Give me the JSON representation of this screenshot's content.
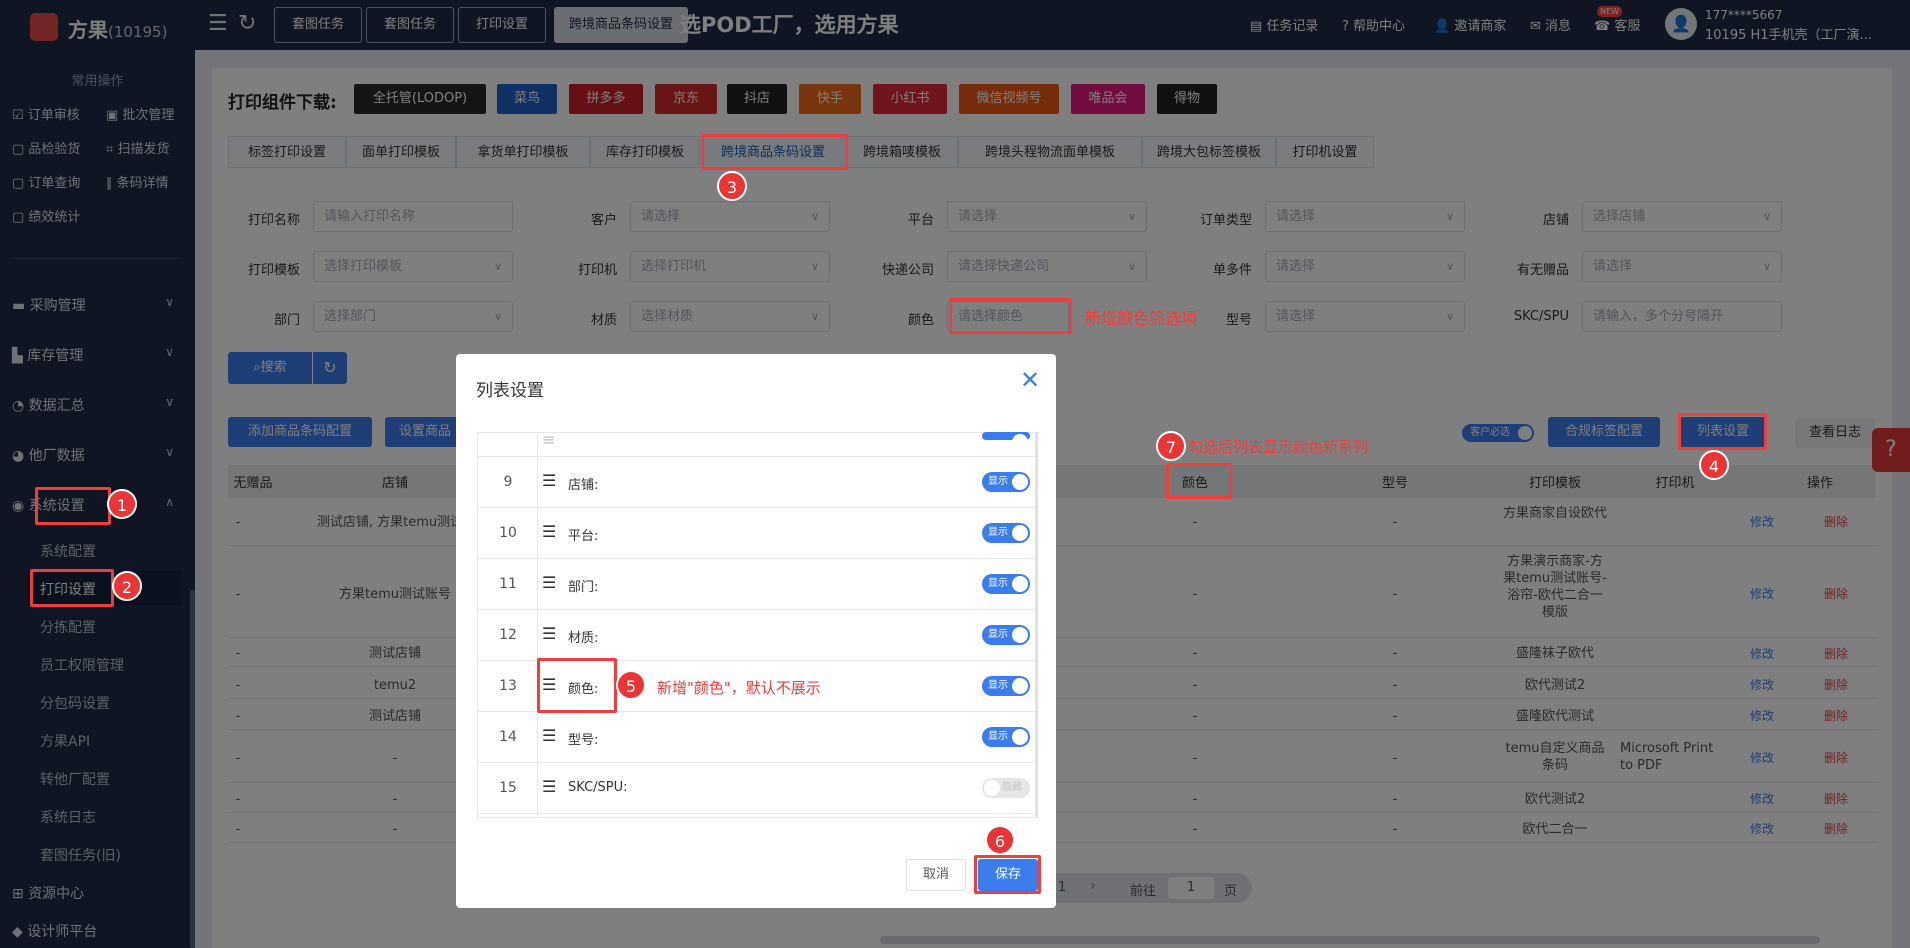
{
  "app": {
    "name": "方果",
    "count": "(10195)"
  },
  "topbar": {
    "buttons": [
      "套图任务",
      "套图任务",
      "打印设置",
      "跨境商品条码设置"
    ],
    "banner": "选POD工厂，选用方果",
    "right": [
      "任务记录",
      "帮助中心",
      "邀请商家",
      "消息",
      "客服"
    ],
    "new_badge": "NEW",
    "user_phone": "177****5667",
    "user_name": "10195  H1手机壳（工厂演..."
  },
  "sidebar": {
    "common_title": "常用操作",
    "quick": [
      "订单审核",
      "批次管理",
      "品检验货",
      "扫描发货",
      "订单查询",
      "条码详情",
      "绩效统计"
    ],
    "menus": [
      "采购管理",
      "库存管理",
      "数据汇总",
      "他厂数据",
      "系统设置"
    ],
    "sub": [
      "系统配置",
      "打印设置",
      "分拣配置",
      "员工权限管理",
      "分包码设置",
      "方果API",
      "转他厂配置",
      "系统日志",
      "套图任务(旧)"
    ],
    "bottom": [
      "资源中心",
      "设计师平台"
    ]
  },
  "downloads": {
    "label": "打印组件下载:",
    "items": [
      "全托管(LODOP)",
      "菜鸟",
      "拼多多",
      "京东",
      "抖店",
      "快手",
      "小红书",
      "微信视频号",
      "唯品会",
      "得物"
    ]
  },
  "tabs": [
    "标签打印设置",
    "面单打印模板",
    "拿货单打印模板",
    "库存打印模板",
    "跨境商品条码设置",
    "跨境箱唛模板",
    "跨境头程物流面单模板",
    "跨境大包标签模板",
    "打印机设置"
  ],
  "filters": {
    "row1": [
      {
        "label": "打印名称",
        "ph": "请输入打印名称"
      },
      {
        "label": "客户",
        "ph": "请选择"
      },
      {
        "label": "平台",
        "ph": "请选择"
      },
      {
        "label": "订单类型",
        "ph": "请选择"
      },
      {
        "label": "店铺",
        "ph": "选择店铺"
      }
    ],
    "row2": [
      {
        "label": "打印模板",
        "ph": "选择打印模板"
      },
      {
        "label": "打印机",
        "ph": "选择打印机"
      },
      {
        "label": "快递公司",
        "ph": "请选择快递公司"
      },
      {
        "label": "单多件",
        "ph": "请选择"
      },
      {
        "label": "有无赠品",
        "ph": "请选择"
      }
    ],
    "row3": [
      {
        "label": "部门",
        "ph": "选择部门"
      },
      {
        "label": "材质",
        "ph": "选择材质"
      },
      {
        "label": "颜色",
        "ph": "请选择颜色"
      },
      {
        "label": "型号",
        "ph": "请选择"
      },
      {
        "label": "SKC/SPU",
        "ph": "请输入，多个分号隔开"
      }
    ],
    "search": "搜索"
  },
  "actions": {
    "add": "添加商品条码配置",
    "set": "设置商品",
    "cust_toggle": "客户必选",
    "compliance": "合规标签配置",
    "columns": "列表设置",
    "log": "查看日志"
  },
  "table": {
    "headers": [
      "无赠品",
      "店铺",
      "颜色",
      "型号",
      "打印模板",
      "打印机",
      "操作"
    ],
    "rows": [
      {
        "gift": "-",
        "shop": "测试店铺, 方果temu测试",
        "color": "-",
        "model": "-",
        "tpl": "方果商家自设欧代",
        "printer": ""
      },
      {
        "gift": "-",
        "shop": "方果temu测试账号",
        "color": "-",
        "model": "-",
        "tpl": "方果演示商家-方果temu测试账号-浴帘-欧代二合一模版",
        "printer": ""
      },
      {
        "gift": "-",
        "shop": "测试店铺",
        "color": "-",
        "model": "-",
        "tpl": "盛隆袜子欧代",
        "printer": ""
      },
      {
        "gift": "-",
        "shop": "temu2",
        "color": "-",
        "model": "-",
        "tpl": "欧代测试2",
        "printer": ""
      },
      {
        "gift": "-",
        "shop": "测试店铺",
        "color": "-",
        "model": "-",
        "tpl": "盛隆欧代测试",
        "printer": ""
      },
      {
        "gift": "-",
        "shop": "-",
        "color": "-",
        "model": "-",
        "tpl": "temu自定义商品条码",
        "printer": "Microsoft Print to PDF"
      },
      {
        "gift": "-",
        "shop": "-",
        "color": "-",
        "model": "-",
        "tpl": "欧代测试2",
        "printer": ""
      },
      {
        "gift": "-",
        "shop": "-",
        "color": "-",
        "model": "-",
        "tpl": "欧代二合一",
        "printer": ""
      }
    ],
    "edit": "修改",
    "delete": "删除"
  },
  "pager": {
    "page": "1",
    "goto": "前往",
    "goto_page": "1",
    "unit": "页"
  },
  "modal": {
    "title": "列表设置",
    "rows": [
      {
        "idx": "9",
        "label": "店铺:",
        "state": "显示"
      },
      {
        "idx": "10",
        "label": "平台:",
        "state": "显示"
      },
      {
        "idx": "11",
        "label": "部门:",
        "state": "显示"
      },
      {
        "idx": "12",
        "label": "材质:",
        "state": "显示"
      },
      {
        "idx": "13",
        "label": "颜色:",
        "state": "显示"
      },
      {
        "idx": "14",
        "label": "型号:",
        "state": "显示"
      },
      {
        "idx": "15",
        "label": "SKC/SPU:",
        "state": "隐藏"
      }
    ],
    "cancel": "取消",
    "save": "保存"
  },
  "annotations": {
    "b1": "1",
    "b2": "2",
    "b3": "3",
    "b4": "4",
    "b5": "5",
    "b6": "6",
    "b7": "7",
    "color_filter_note": "新增颜色筛选项",
    "modal_note": "新增\"颜色\"，默认不展示",
    "column_note": "勾选后列表显示颜色新系列"
  }
}
